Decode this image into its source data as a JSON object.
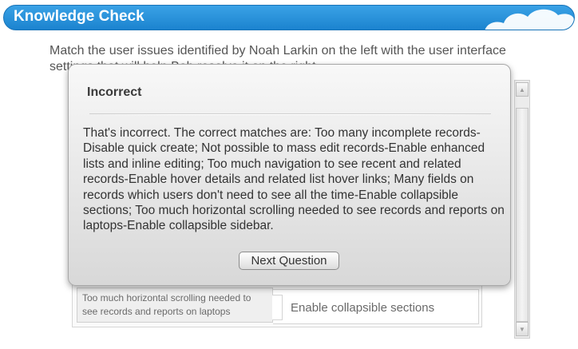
{
  "header": {
    "title": "Knowledge Check",
    "accent_color": "#1b83cf"
  },
  "instructions": "Match the user issues identified by Noah Larkin on the left with the user interface settings that will help Bob resolve it on the right.",
  "match_row": {
    "issue": "Too much horizontal scrolling needed to see records and reports on laptops",
    "setting": "Enable collapsible sections"
  },
  "feedback": {
    "title": "Incorrect",
    "body": "That's incorrect. The correct matches are: Too many incomplete records-Disable quick create; Not possible to mass edit records-Enable enhanced lists and inline editing; Too much navigation to see recent and related records-Enable hover details and related list hover links; Many fields on records which users don't need to see all the time-Enable collapsible sections; Too much horizontal scrolling needed to see records and reports on laptops-Enable collapsible sidebar.",
    "next_button_label": "Next Question"
  },
  "icons": {
    "decor": "cloud-icon",
    "scroll_up": "triangle-up-icon",
    "scroll_down": "triangle-down-icon"
  }
}
